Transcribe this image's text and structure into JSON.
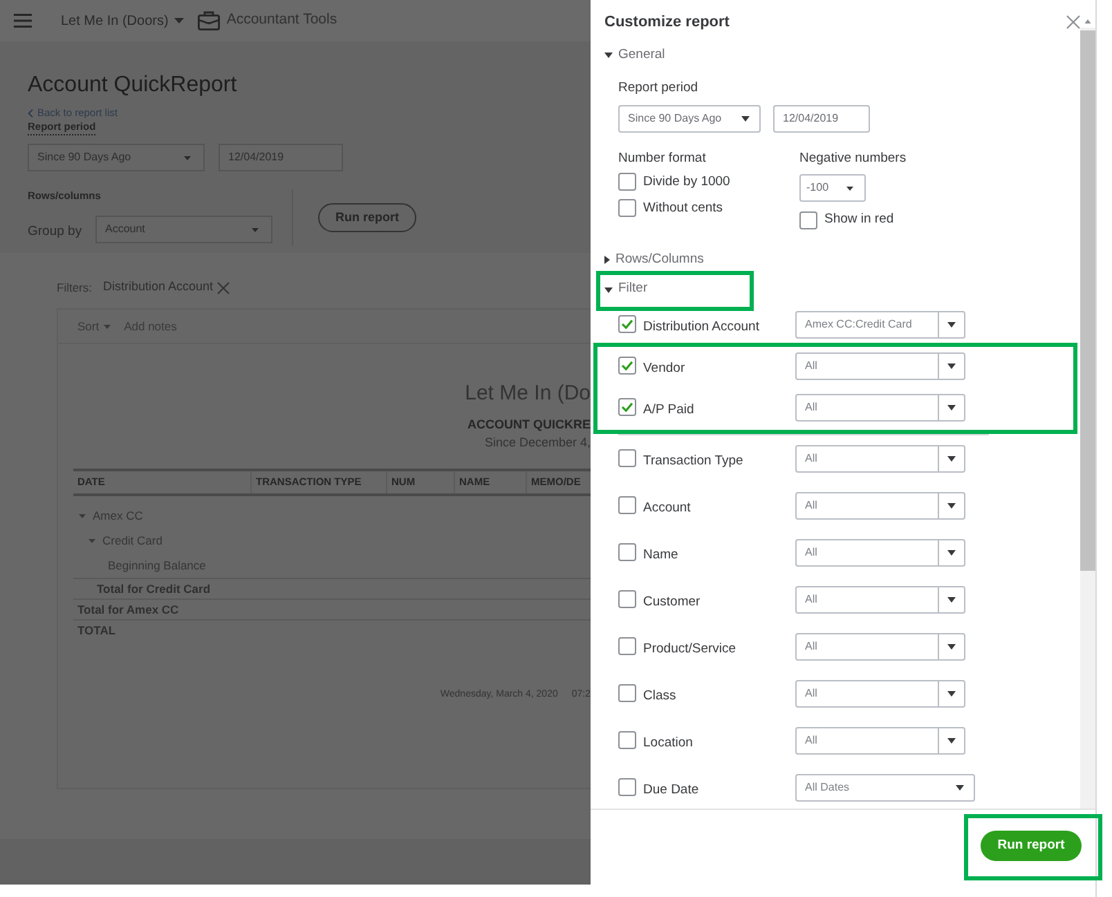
{
  "top_bar": {
    "company": "Let Me In (Doors)",
    "tools": "Accountant Tools"
  },
  "header": {
    "title": "Account QuickReport",
    "back_link": "Back to report list",
    "period_label": "Report period",
    "period": "Since 90 Days Ago",
    "date": "12/04/2019",
    "rows_columns_label": "Rows/columns",
    "group_by_label": "Group by",
    "group_by": "Account",
    "run_button": "Run report"
  },
  "filters_bar": {
    "label": "Filters:",
    "chips": [
      {
        "label": "Distribution Account"
      }
    ]
  },
  "report": {
    "toolbar": [
      {
        "kind": "menu",
        "label": "Sort"
      },
      {
        "kind": "link",
        "label": "Add notes"
      }
    ],
    "company": "Let Me In (Do",
    "title": "ACCOUNT QUICKRE",
    "period": "Since December 4,",
    "columns": [
      "DATE",
      "TRANSACTION TYPE",
      "NUM",
      "NAME",
      "MEMO/DE"
    ],
    "rows": [
      {
        "label": "Amex CC",
        "expanded": true,
        "children": [
          {
            "label": "Credit Card",
            "expanded": true,
            "children": [
              {
                "label": "Beginning Balance"
              }
            ],
            "total": "Total for Credit Card"
          }
        ],
        "total": "Total for Amex CC"
      }
    ],
    "grand_total": "TOTAL",
    "footer": {
      "date": "Wednesday, March 4, 2020",
      "time": "07:2"
    }
  },
  "panel": {
    "title": "Customize report",
    "general": {
      "label": "General",
      "expanded": true,
      "report_period": {
        "label": "Report period",
        "period": "Since 90 Days Ago",
        "date": "12/04/2019"
      },
      "number_format": {
        "label": "Number format",
        "options": [
          {
            "label": "Divide by 1000",
            "checked": false
          },
          {
            "label": "Without cents",
            "checked": false
          }
        ]
      },
      "negative_numbers": {
        "label": "Negative numbers",
        "value": "-100",
        "show_in_red": {
          "label": "Show in red",
          "checked": false
        }
      }
    },
    "rows_columns": {
      "label": "Rows/Columns",
      "expanded": false
    },
    "filter": {
      "label": "Filter",
      "expanded": true,
      "highlighted": true,
      "rows": [
        {
          "label": "Distribution Account",
          "checked": true,
          "highlighted": false,
          "kind": "split",
          "value": "Amex CC:Credit Card"
        },
        {
          "label": "Vendor",
          "checked": true,
          "highlighted": true,
          "kind": "split",
          "value": "All"
        },
        {
          "label": "A/P Paid",
          "checked": true,
          "highlighted": true,
          "kind": "split",
          "value": "All"
        },
        {
          "label": "Transaction Type",
          "checked": false,
          "highlighted": false,
          "kind": "split",
          "value": "All"
        },
        {
          "label": "Account",
          "checked": false,
          "highlighted": false,
          "kind": "split",
          "value": "All"
        },
        {
          "label": "Name",
          "checked": false,
          "highlighted": false,
          "kind": "split",
          "value": "All"
        },
        {
          "label": "Customer",
          "checked": false,
          "highlighted": false,
          "kind": "split",
          "value": "All"
        },
        {
          "label": "Product/Service",
          "checked": false,
          "highlighted": false,
          "kind": "split",
          "value": "All"
        },
        {
          "label": "Class",
          "checked": false,
          "highlighted": false,
          "kind": "split",
          "value": "All"
        },
        {
          "label": "Location",
          "checked": false,
          "highlighted": false,
          "kind": "split",
          "value": "All"
        },
        {
          "label": "Due Date",
          "checked": false,
          "highlighted": false,
          "kind": "dropdown",
          "value": "All Dates"
        }
      ]
    },
    "run_button": {
      "label": "Run report",
      "highlighted": true
    }
  }
}
